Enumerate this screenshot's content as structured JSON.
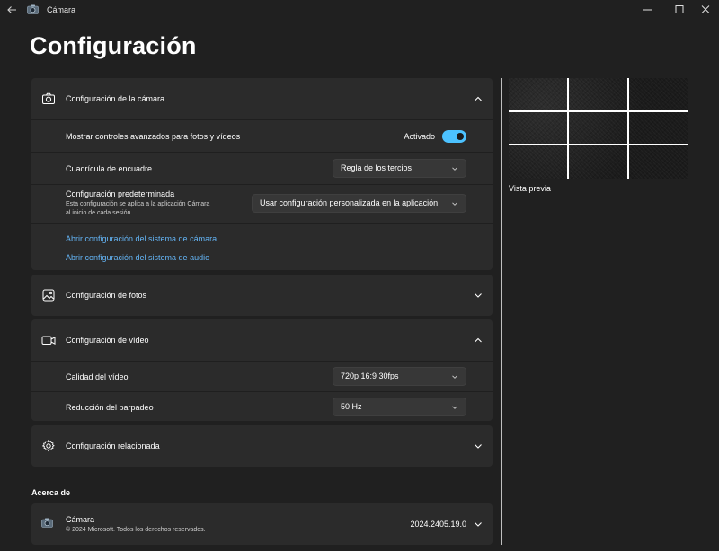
{
  "window": {
    "app_title": "Cámara",
    "controls": {
      "minimize": "—",
      "maximize": "☐",
      "close": "✕"
    }
  },
  "page": {
    "title": "Configuración"
  },
  "camera_settings": {
    "title": "Configuración de la cámara",
    "expanded": true,
    "advanced_controls": {
      "label": "Mostrar controles avanzados para fotos y vídeos",
      "state_label": "Activado",
      "on": true
    },
    "framing_grid": {
      "label": "Cuadrícula de encuadre",
      "value": "Regla de los tercios"
    },
    "default_settings": {
      "label": "Configuración predeterminada",
      "description_line1": "Esta configuración se aplica a la aplicación Cámara",
      "description_line2": "al inicio de cada sesión",
      "value": "Usar configuración personalizada en la aplicación"
    },
    "links": [
      "Abrir configuración del sistema de cámara",
      "Abrir configuración del sistema de audio"
    ]
  },
  "photo_settings": {
    "title": "Configuración de fotos",
    "expanded": false
  },
  "video_settings": {
    "title": "Configuración de vídeo",
    "expanded": true,
    "quality": {
      "label": "Calidad del vídeo",
      "value": "720p 16:9 30fps"
    },
    "flicker": {
      "label": "Reducción del parpadeo",
      "value": "50 Hz"
    }
  },
  "related_settings": {
    "title": "Configuración relacionada",
    "expanded": false
  },
  "preview": {
    "label": "Vista previa"
  },
  "about": {
    "section_title": "Acerca de",
    "app_name": "Cámara",
    "copyright": "© 2024 Microsoft. Todos los derechos reservados.",
    "version": "2024.2405.19.0"
  },
  "colors": {
    "accent": "#4cc2ff",
    "link": "#64b5f6",
    "card": "#2b2b2b",
    "background": "#202020"
  }
}
